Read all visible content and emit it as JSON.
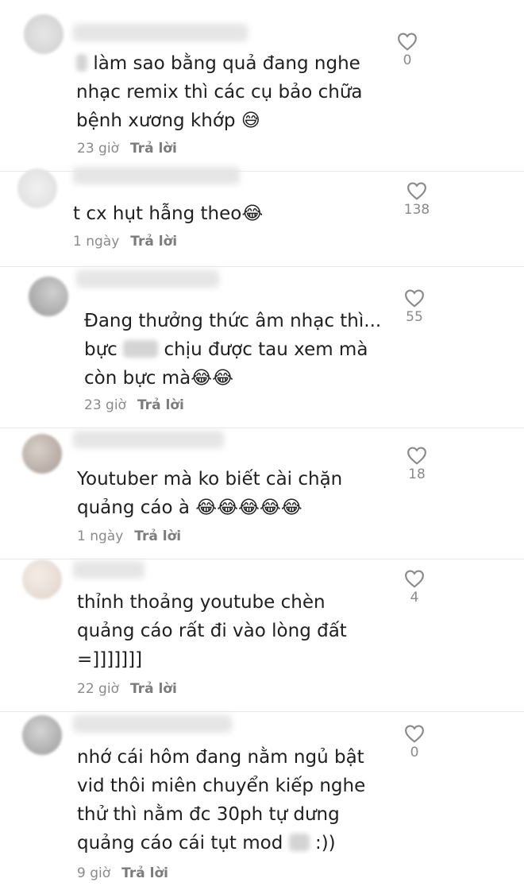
{
  "comments": [
    {
      "lines": [
        "làm sao bằng quả đang nghe",
        "nhạc remix thì các cụ bảo chữa",
        "bệnh xương khớp 😅"
      ],
      "time": "23 giờ",
      "reply": "Trả lời",
      "likes": "0"
    },
    {
      "lines": [
        "t cx hụt hẫng theo😂"
      ],
      "time": "1 ngày",
      "reply": "Trả lời",
      "likes": "138"
    },
    {
      "lines": [
        "Đang thưởng thức âm nhạc thì...",
        "bực",
        "chịu được tau xem mà",
        "còn bực mà😂😂"
      ],
      "time": "23 giờ",
      "reply": "Trả lời",
      "likes": "55"
    },
    {
      "lines": [
        "Youtuber mà ko biết cài chặn",
        "quảng cáo à 😂😂😂😂😂"
      ],
      "time": "1 ngày",
      "reply": "Trả lời",
      "likes": "18"
    },
    {
      "lines": [
        "thỉnh thoảng youtube chèn",
        "quảng cáo rất đi vào lòng đất",
        "=]]]]]]]"
      ],
      "time": "22 giờ",
      "reply": "Trả lời",
      "likes": "4"
    },
    {
      "lines": [
        "nhớ cái hôm đang nằm ngủ bật",
        "vid thôi miên chuyển kiếp nghe",
        "thử thì nằm đc 30ph tự dưng",
        "quảng cáo cái tụt mod",
        ":))"
      ],
      "time": "9 giờ",
      "reply": "Trả lời",
      "likes": "0"
    }
  ]
}
